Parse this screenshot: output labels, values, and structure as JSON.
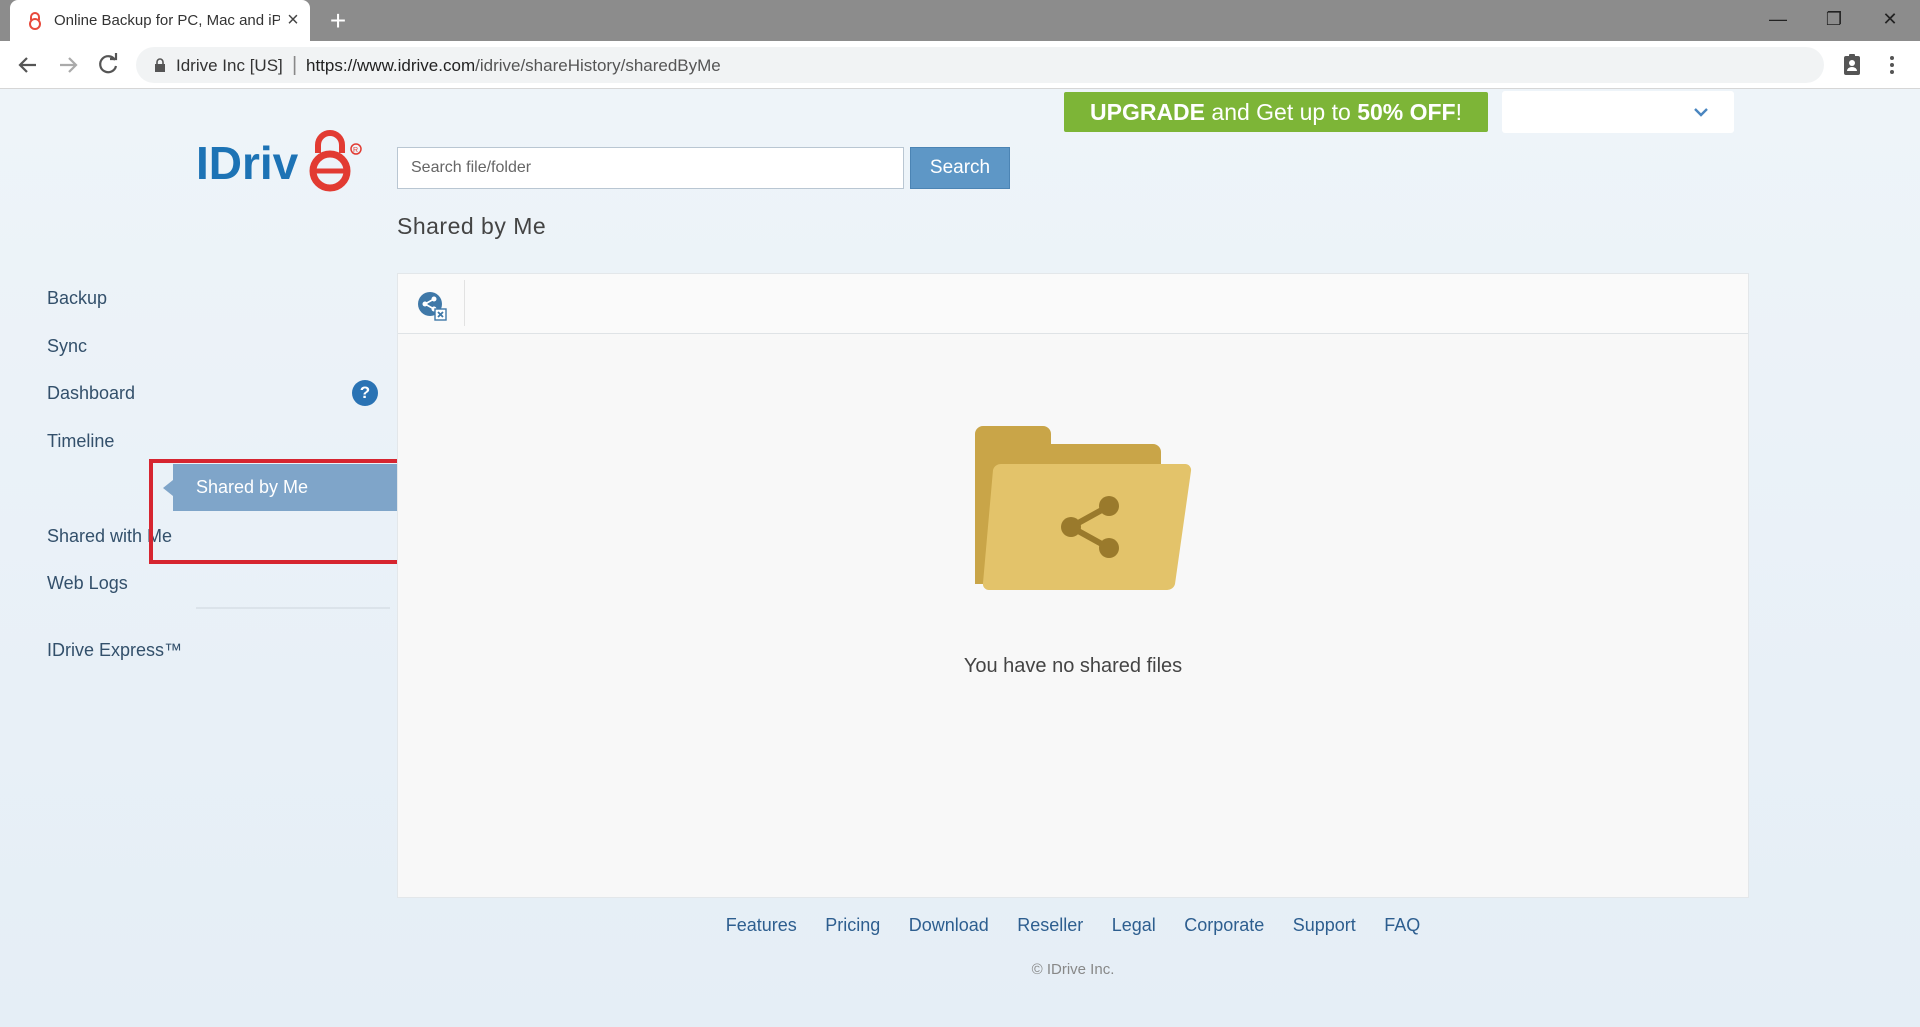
{
  "browser": {
    "tab_title": "Online Backup for PC, Mac and iPhone",
    "new_tab_label": "+",
    "site_identity": "Idrive Inc [US]",
    "url_scheme_host": "https://www.idrive.com",
    "url_path": "/idrive/shareHistory/sharedByMe",
    "window_controls": [
      "minimize-icon",
      "restore-icon",
      "close-icon"
    ]
  },
  "header": {
    "upgrade_banner": {
      "word1": "UPGRADE",
      "middle": " and Get up to ",
      "discount": "50% OFF",
      "end": "!"
    },
    "account_dropdown_value": ""
  },
  "search": {
    "placeholder": "Search file/folder",
    "value": "",
    "button_label": "Search"
  },
  "page_title": "Shared by Me",
  "sidebar": {
    "items": [
      {
        "label": "Backup"
      },
      {
        "label": "Sync"
      },
      {
        "label": "Dashboard",
        "help": "?"
      },
      {
        "label": "Timeline"
      },
      {
        "label": "Shared by Me",
        "active": true
      },
      {
        "label": "Shared with Me"
      },
      {
        "label": "Web Logs"
      },
      {
        "label": "IDrive Express™"
      }
    ]
  },
  "main": {
    "empty_message": "You have no shared files"
  },
  "footer": {
    "links": [
      "Features",
      "Pricing",
      "Download",
      "Reseller",
      "Legal",
      "Corporate",
      "Support",
      "FAQ"
    ],
    "copyright": "© IDrive Inc."
  },
  "colors": {
    "accent": "#5e97c6",
    "active_nav": "#7fa5c9",
    "upgrade_green": "#7db537",
    "highlight_red": "#d62530",
    "folder": "#d9b85a"
  }
}
